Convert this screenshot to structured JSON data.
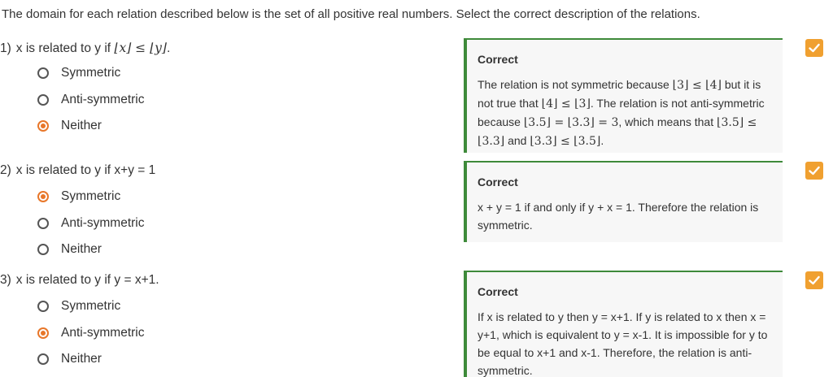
{
  "instructions": "The domain for each relation described below is the set of all positive real numbers. Select the correct description of the relations.",
  "questions": [
    {
      "number": "1)",
      "prompt_pre": "x is related to y if ",
      "prompt_math": "⌊x⌋ ≤ ⌊y⌋",
      "prompt_post": ".",
      "options": [
        "Symmetric",
        "Anti-symmetric",
        "Neither"
      ],
      "selected": "Neither",
      "feedback_title": "Correct",
      "feedback": [
        {
          "t": "The relation is not symmetric because "
        },
        {
          "m": "⌊3⌋ ≤ ⌊4⌋"
        },
        {
          "t": " but it is not true that "
        },
        {
          "m": "⌊4⌋ ≤ ⌊3⌋"
        },
        {
          "t": ". The relation is not anti-symmetric because "
        },
        {
          "m": "⌊3.5⌋ = ⌊3.3⌋ = 3"
        },
        {
          "t": ", which means that "
        },
        {
          "m": "⌊3.5⌋ ≤ ⌊3.3⌋"
        },
        {
          "t": " and "
        },
        {
          "m": "⌊3.3⌋ ≤ ⌊3.5⌋"
        },
        {
          "t": "."
        }
      ]
    },
    {
      "number": "2)",
      "prompt_pre": "x is related to y if x+y = 1",
      "prompt_math": "",
      "prompt_post": "",
      "options": [
        "Symmetric",
        "Anti-symmetric",
        "Neither"
      ],
      "selected": "Symmetric",
      "feedback_title": "Correct",
      "feedback": [
        {
          "t": "x + y = 1 if and only if y + x = 1. Therefore the relation is symmetric."
        }
      ]
    },
    {
      "number": "3)",
      "prompt_pre": "x is related to y if y = x+1.",
      "prompt_math": "",
      "prompt_post": "",
      "options": [
        "Symmetric",
        "Anti-symmetric",
        "Neither"
      ],
      "selected": "Anti-symmetric",
      "feedback_title": "Correct",
      "feedback": [
        {
          "t": "If x is related to y then y = x+1. If y is related to x then x = y+1, which is equivalent to y = x-1. It is impossible for y to be equal to x+1 and x-1. Therefore, the relation is anti-symmetric."
        }
      ]
    }
  ],
  "colors": {
    "accent_orange": "#e8772a",
    "check_badge": "#f0a030",
    "feedback_border": "#3e8a3a"
  },
  "icons": {
    "status": "checkmark-icon"
  }
}
